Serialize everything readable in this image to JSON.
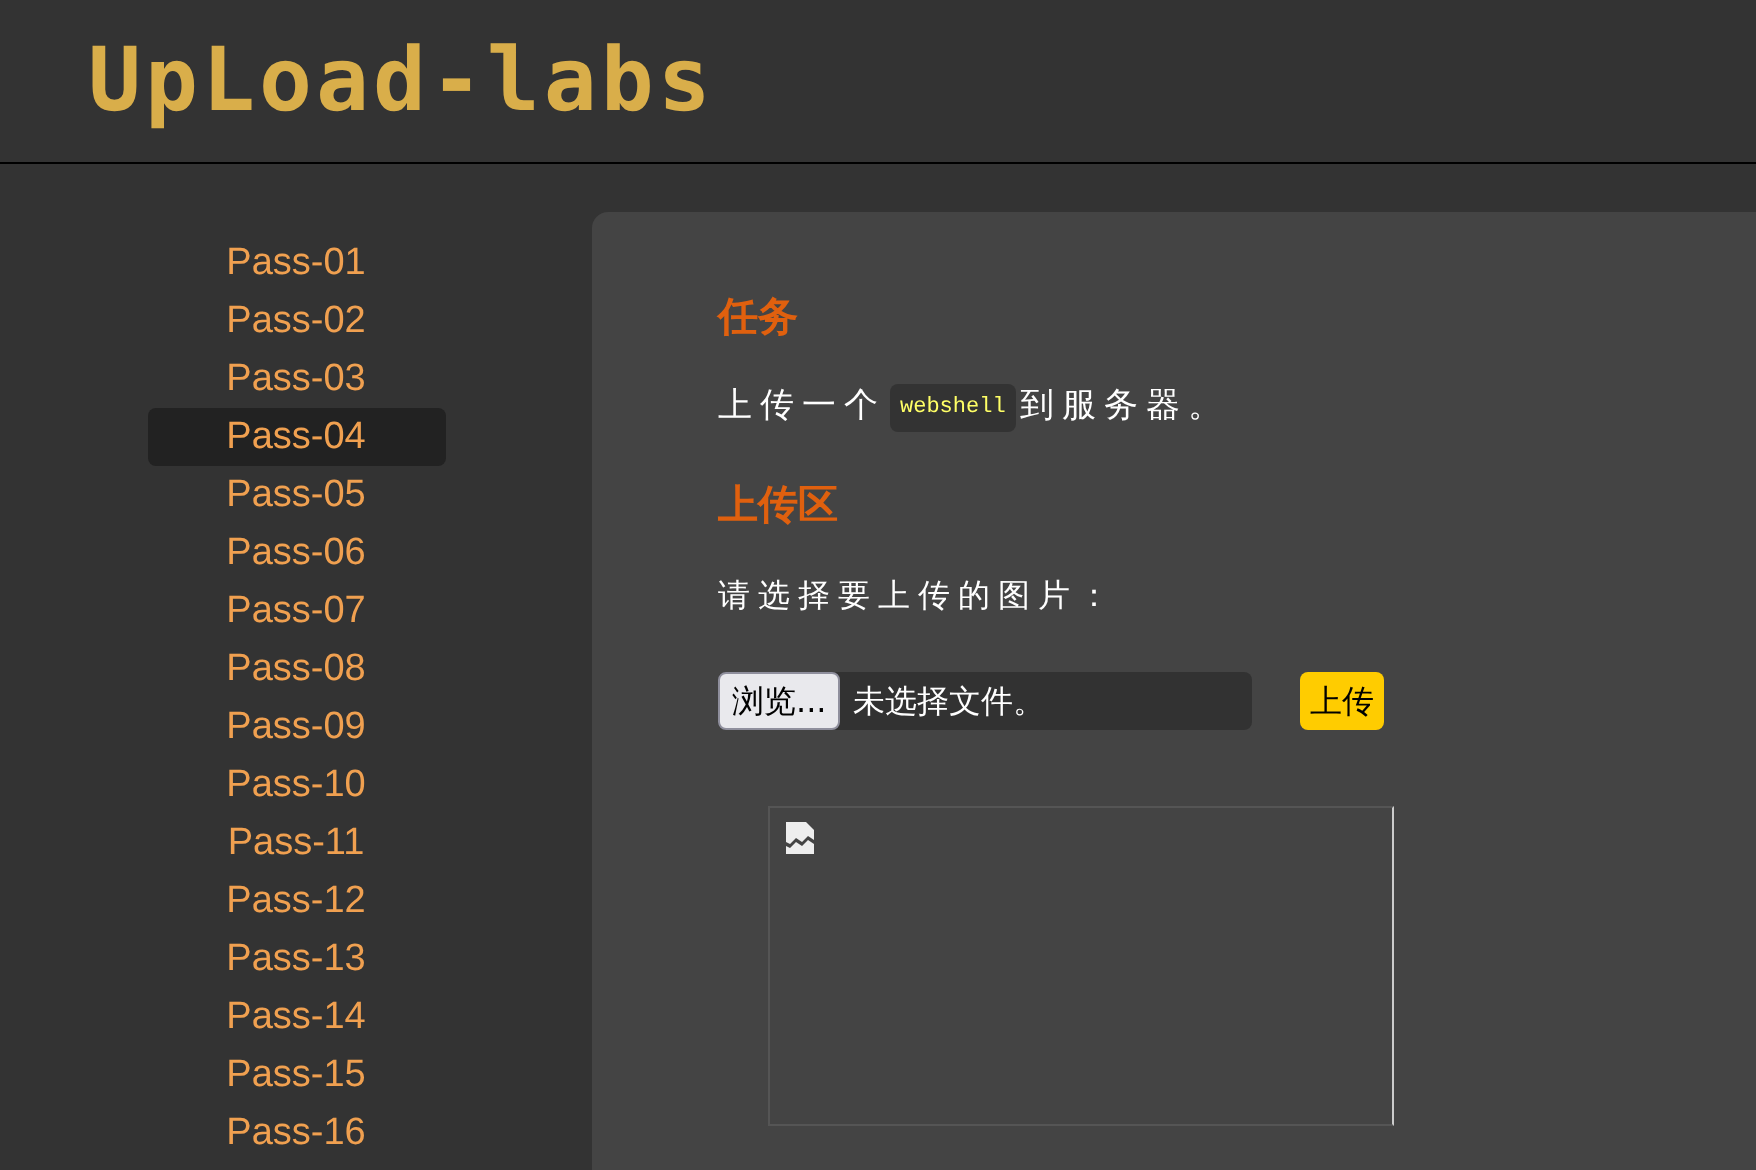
{
  "header": {
    "logo": "UpLoad-labs"
  },
  "sidebar": {
    "items": [
      {
        "label": "Pass-01",
        "selected": false
      },
      {
        "label": "Pass-02",
        "selected": false
      },
      {
        "label": "Pass-03",
        "selected": false
      },
      {
        "label": "Pass-04",
        "selected": true
      },
      {
        "label": "Pass-05",
        "selected": false
      },
      {
        "label": "Pass-06",
        "selected": false
      },
      {
        "label": "Pass-07",
        "selected": false
      },
      {
        "label": "Pass-08",
        "selected": false
      },
      {
        "label": "Pass-09",
        "selected": false
      },
      {
        "label": "Pass-10",
        "selected": false
      },
      {
        "label": "Pass-11",
        "selected": false
      },
      {
        "label": "Pass-12",
        "selected": false
      },
      {
        "label": "Pass-13",
        "selected": false
      },
      {
        "label": "Pass-14",
        "selected": false
      },
      {
        "label": "Pass-15",
        "selected": false
      },
      {
        "label": "Pass-16",
        "selected": false
      }
    ]
  },
  "task": {
    "heading": "任务",
    "text_before": "上传一个",
    "code": "webshell",
    "text_after": "到服务器。"
  },
  "upload": {
    "heading": "上传区",
    "prompt": "请选择要上传的图片：",
    "browse_button": "浏览...",
    "file_status": "未选择文件。",
    "submit_button": "上传"
  },
  "preview": {
    "broken_image": true
  }
}
